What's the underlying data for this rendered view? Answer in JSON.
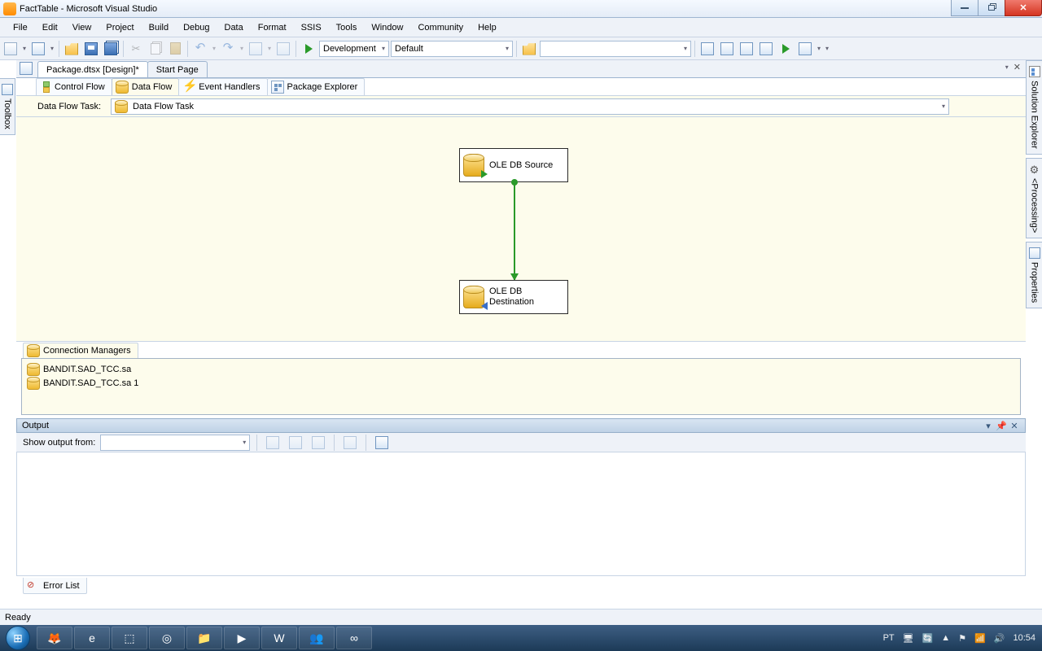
{
  "window": {
    "title": "FactTable - Microsoft Visual Studio"
  },
  "menu": [
    "File",
    "Edit",
    "View",
    "Project",
    "Build",
    "Debug",
    "Data",
    "Format",
    "SSIS",
    "Tools",
    "Window",
    "Community",
    "Help"
  ],
  "toolbar": {
    "config": "Development",
    "platform": "Default"
  },
  "tabs": {
    "activeDoc": "Package.dtsx [Design]*",
    "startPage": "Start Page"
  },
  "designerTabs": {
    "controlFlow": "Control Flow",
    "dataFlow": "Data Flow",
    "eventHandlers": "Event Handlers",
    "packageExplorer": "Package Explorer"
  },
  "dft": {
    "label": "Data Flow Task:",
    "value": "Data Flow Task"
  },
  "nodes": {
    "source": "OLE DB Source",
    "dest": "OLE DB\nDestination",
    "destLine1": "OLE DB",
    "destLine2": "Destination"
  },
  "cm": {
    "tab": "Connection Managers",
    "items": [
      "BANDIT.SAD_TCC.sa",
      "BANDIT.SAD_TCC.sa 1"
    ]
  },
  "output": {
    "title": "Output",
    "showFromLabel": "Show output from:"
  },
  "errorList": "Error List",
  "status": {
    "ready": "Ready"
  },
  "rail": {
    "solution": "Solution Explorer",
    "processing": "<Processing>",
    "properties": "Properties",
    "toolbox": "Toolbox"
  },
  "tray": {
    "lang": "PT",
    "time": "10:54"
  }
}
